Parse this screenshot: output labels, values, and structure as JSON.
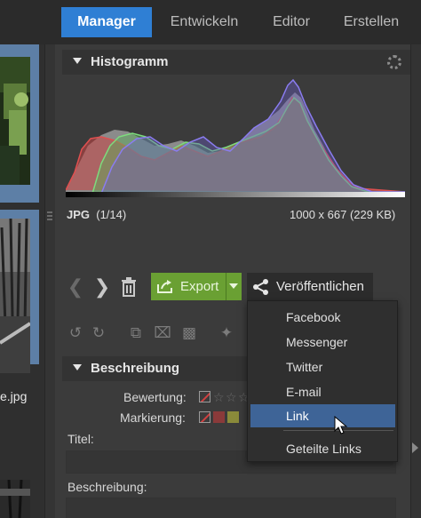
{
  "tabs": [
    {
      "label": "Manager",
      "active": true
    },
    {
      "label": "Entwickeln",
      "active": false
    },
    {
      "label": "Editor",
      "active": false
    },
    {
      "label": "Erstellen",
      "active": false
    }
  ],
  "filmstrip": {
    "selected_caption": "e.jpg"
  },
  "histogram": {
    "title": "Histogramm",
    "format": "JPG",
    "index": "(1/14)",
    "dimensions": "1000 x 667 (229 KB)"
  },
  "toolbar": {
    "export_label": "Export",
    "share_label": "Veröffentlichen"
  },
  "share_menu": {
    "items": [
      "Facebook",
      "Messenger",
      "Twitter",
      "E-mail",
      "Link",
      "Geteilte Links"
    ],
    "highlighted": "Link"
  },
  "description": {
    "title": "Beschreibung",
    "rating_label": "Bewertung:",
    "marking_label": "Markierung:",
    "title_label": "Titel:",
    "description_label": "Beschreibung:"
  },
  "colors": {
    "accent": "#2f7fd4",
    "export_green": "#6aa033",
    "menu_highlight": "#3e6497"
  }
}
